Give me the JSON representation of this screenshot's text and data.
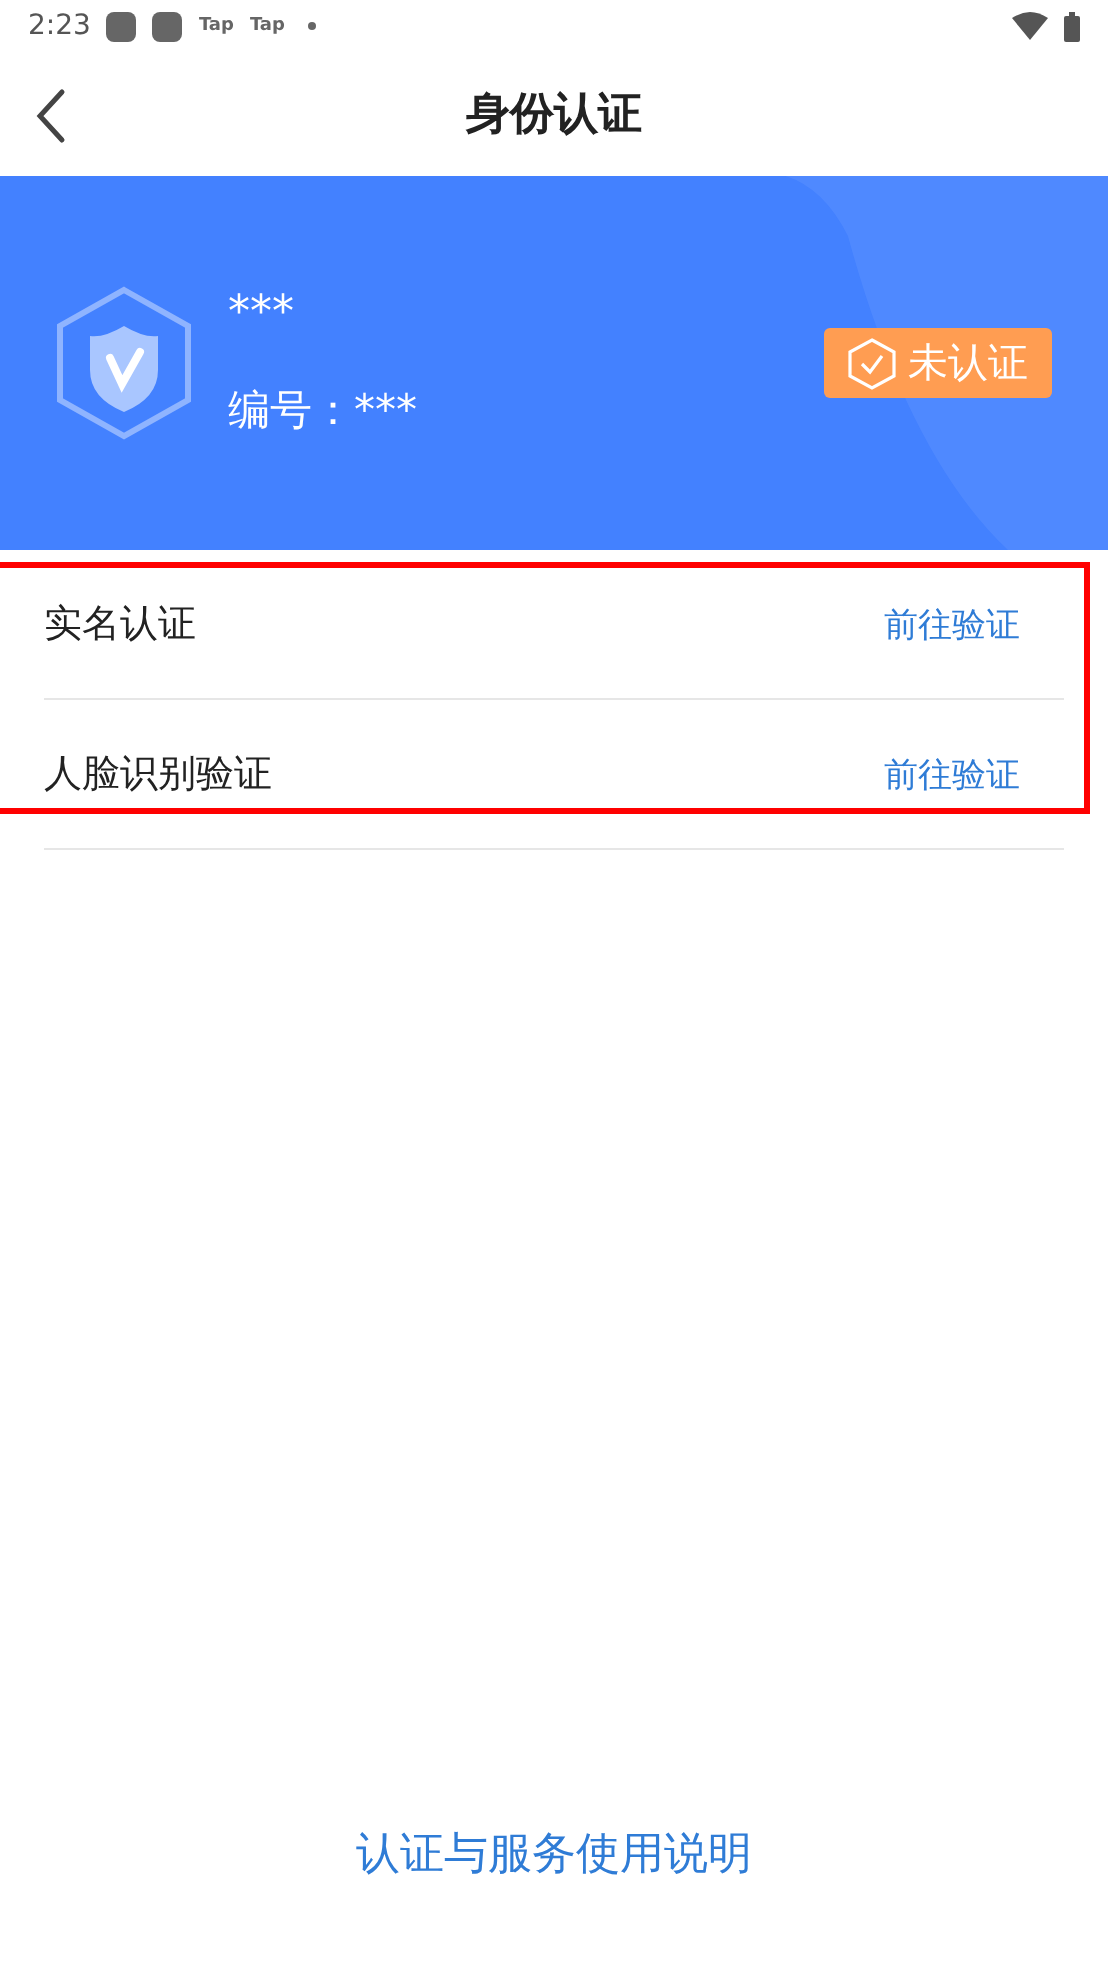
{
  "status_bar": {
    "time": "2:23",
    "notifications": [
      "Tap",
      "Tap"
    ]
  },
  "header": {
    "title": "身份认证"
  },
  "profile": {
    "name": "***",
    "number_label": "编号：",
    "number": "***",
    "badge": "未认证",
    "verified": false
  },
  "items": [
    {
      "label": "实名认证",
      "action": "前往验证"
    },
    {
      "label": "人脸识别验证",
      "action": "前往验证"
    }
  ],
  "footer_link": "认证与服务使用说明"
}
